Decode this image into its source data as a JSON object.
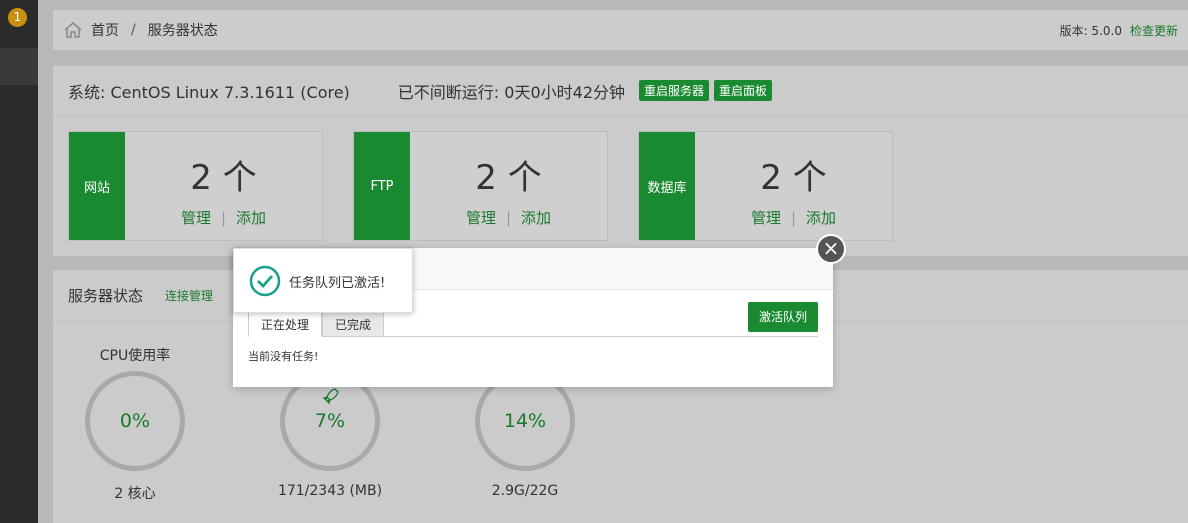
{
  "sidebar": {
    "badge": "1"
  },
  "breadcrumb": {
    "home": "首页",
    "separator": "/",
    "current": "服务器状态"
  },
  "version": {
    "label": "版本: 5.0.0",
    "check_update": "检查更新"
  },
  "system": {
    "os": "系统: CentOS Linux 7.3.1611 (Core)",
    "uptime": "已不间断运行: 0天0小时42分钟",
    "restart_server": "重启服务器",
    "restart_panel": "重启面板"
  },
  "stats": [
    {
      "label": "网站",
      "count": "2 个",
      "manage": "管理",
      "divider": "|",
      "add": "添加"
    },
    {
      "label": "FTP",
      "count": "2 个",
      "manage": "管理",
      "divider": "|",
      "add": "添加"
    },
    {
      "label": "数据库",
      "count": "2 个",
      "manage": "管理",
      "divider": "|",
      "add": "添加"
    }
  ],
  "server_status": {
    "title": "服务器状态",
    "link": "连接管理",
    "gauges": [
      {
        "title": "CPU使用率",
        "value": "0%",
        "caption": "2 核心"
      },
      {
        "title": "",
        "value": "7%",
        "caption": "171/2343 (MB)"
      },
      {
        "title": "",
        "value": "14%",
        "caption": "2.9G/22G"
      }
    ]
  },
  "dialog": {
    "tabs": [
      "正在处理",
      "已完成"
    ],
    "activate_button": "激活队列",
    "empty_text": "当前没有任务!",
    "close_icon": "close-icon"
  },
  "toast": {
    "message": "任务队列已激活!",
    "icon": "check-circle-icon"
  },
  "colors": {
    "green": "#1a8a30",
    "sidebar": "#2b2b2b",
    "overlay": "#bcbcbc"
  }
}
